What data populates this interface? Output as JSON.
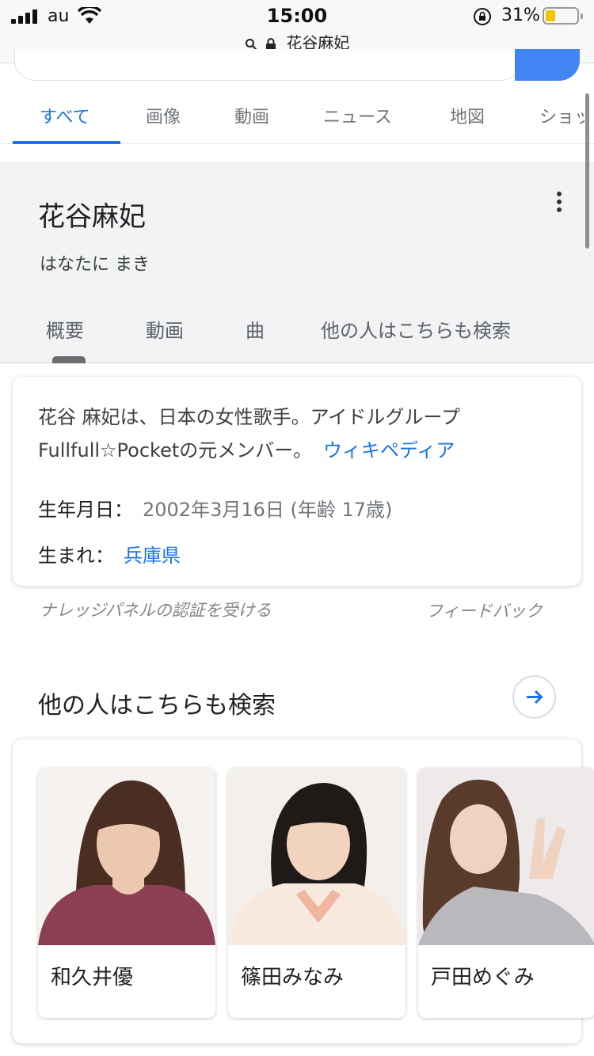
{
  "status_bar": {
    "carrier": "au",
    "time": "15:00",
    "battery": "31%",
    "battery_level": 0.31
  },
  "browser": {
    "url_text": "花谷麻妃"
  },
  "tabs": [
    {
      "label": "すべて",
      "active": true
    },
    {
      "label": "画像"
    },
    {
      "label": "動画"
    },
    {
      "label": "ニュース"
    },
    {
      "label": "地図"
    },
    {
      "label": "ショッ"
    }
  ],
  "knowledge_panel": {
    "title": "花谷麻妃",
    "reading": "はなたに まき",
    "tabs": [
      "概要",
      "動画",
      "曲",
      "他の人はこちらも検索"
    ],
    "description": "花谷 麻妃は、日本の女性歌手。アイドルグループFullfull☆Pocketの元メンバー。",
    "source_link": "ウィキペディア",
    "facts": [
      {
        "label": "生年月日：",
        "value": "2002年3月16日 (年齢 17歳)"
      },
      {
        "label": "生まれ：",
        "value": "兵庫県"
      }
    ],
    "claim_text": "ナレッジパネルの認証を受ける",
    "feedback": "フィードバック"
  },
  "people_also_search": {
    "title": "他の人はこちらも検索",
    "people": [
      {
        "name": "和久井優"
      },
      {
        "name": "篠田みなみ"
      },
      {
        "name": "戸田めぐみ"
      }
    ]
  },
  "colors": {
    "accent": "#1a73e8",
    "search_button": "#4285f4",
    "panel_bg": "#f1f3f4"
  }
}
